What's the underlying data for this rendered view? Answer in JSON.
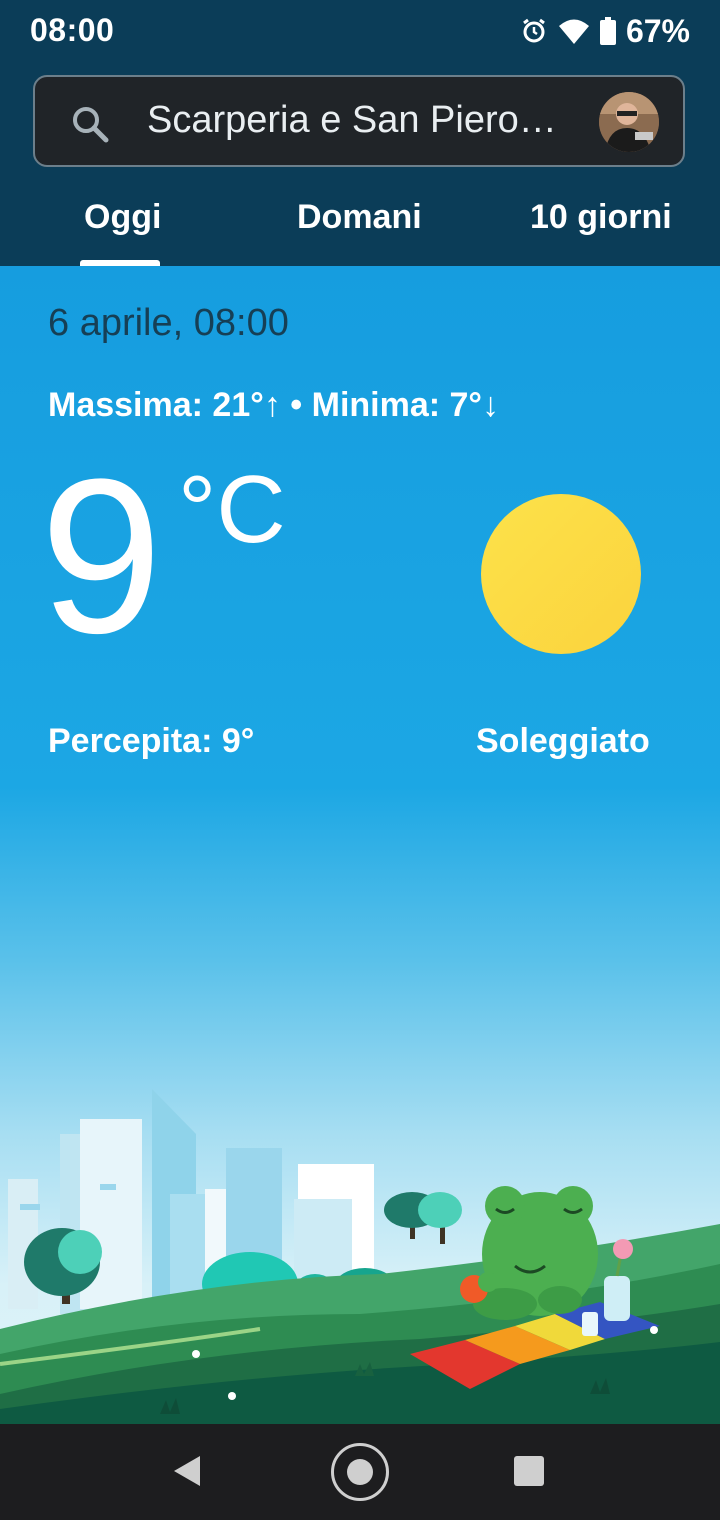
{
  "status_bar": {
    "time": "08:00",
    "battery_percent": "67%",
    "icons": [
      "alarm-icon",
      "wifi-icon",
      "battery-icon"
    ]
  },
  "search": {
    "location": "Scarperia e San Piero…"
  },
  "tabs": [
    {
      "label": "Oggi",
      "selected": true
    },
    {
      "label": "Domani",
      "selected": false
    },
    {
      "label": "10 giorni",
      "selected": false
    }
  ],
  "weather": {
    "date": "6 aprile, 08:00",
    "minmax": "Massima: 21°↑ • Minima: 7°↓",
    "temperature": "9",
    "unit": "°C",
    "feels_like": "Percepita: 9°",
    "condition": "Soleggiato",
    "condition_icon": "sun-icon"
  },
  "colors": {
    "header_bg": "#0b3d58",
    "sky_top": "#169ddf",
    "sun": "#fcd842",
    "grass": "#2a8a4f"
  }
}
